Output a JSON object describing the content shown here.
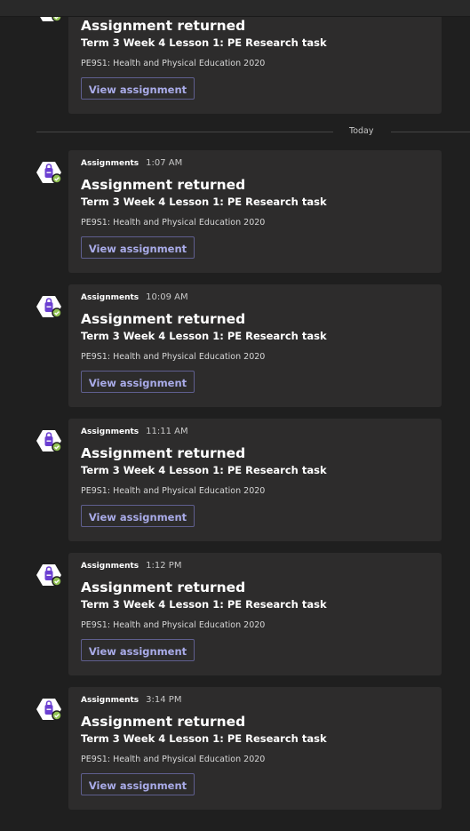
{
  "divider": {
    "label": "Today"
  },
  "messages": [
    {
      "sender": "",
      "time": "",
      "title": "Assignment returned",
      "subtitle": "Term 3 Week 4 Lesson 1: PE Research task",
      "classname": "PE9S1: Health and Physical Education 2020",
      "button_label": "View assignment"
    },
    {
      "sender": "Assignments",
      "time": "1:07 AM",
      "title": "Assignment returned",
      "subtitle": "Term 3 Week 4 Lesson 1: PE Research task",
      "classname": "PE9S1: Health and Physical Education 2020",
      "button_label": "View assignment"
    },
    {
      "sender": "Assignments",
      "time": "10:09 AM",
      "title": "Assignment returned",
      "subtitle": "Term 3 Week 4 Lesson 1: PE Research task",
      "classname": "PE9S1: Health and Physical Education 2020",
      "button_label": "View assignment"
    },
    {
      "sender": "Assignments",
      "time": "11:11 AM",
      "title": "Assignment returned",
      "subtitle": "Term 3 Week 4 Lesson 1: PE Research task",
      "classname": "PE9S1: Health and Physical Education 2020",
      "button_label": "View assignment"
    },
    {
      "sender": "Assignments",
      "time": "1:12 PM",
      "title": "Assignment returned",
      "subtitle": "Term 3 Week 4 Lesson 1: PE Research task",
      "classname": "PE9S1: Health and Physical Education 2020",
      "button_label": "View assignment"
    },
    {
      "sender": "Assignments",
      "time": "3:14 PM",
      "title": "Assignment returned",
      "subtitle": "Term 3 Week 4 Lesson 1: PE Research task",
      "classname": "PE9S1: Health and Physical Education 2020",
      "button_label": "View assignment"
    }
  ],
  "colors": {
    "background": "#1f1f1f",
    "card": "#2d2c2c",
    "accent": "#5b5fc7",
    "icon_purple": "#6b3fd1",
    "badge_green": "#92c353"
  },
  "icons": {
    "app": "assignments-backpack-icon",
    "badge": "check-badge-icon"
  }
}
